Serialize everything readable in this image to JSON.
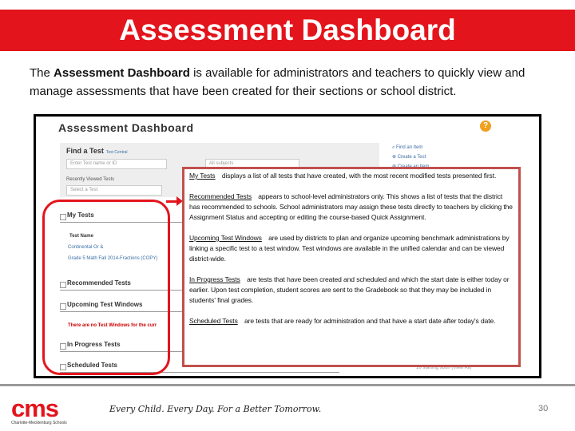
{
  "slide": {
    "title": "Assessment Dashboard",
    "intro_prefix": "The ",
    "intro_bold": "Assessment Dashboard",
    "intro_rest": " is available for administrators and teachers to quickly view and  manage assessments that have been created for their sections or school district.",
    "page_number": "30",
    "tagline": "Every Child. Every Day. For a Better Tomorrow.",
    "logo_text": "cms",
    "logo_subtext": "Charlotte-Mecklenburg Schools"
  },
  "screenshot": {
    "title": "Assessment Dashboard",
    "help_icon": "?",
    "find": {
      "label": "Find a Test",
      "link": "Test Central",
      "name_placeholder": "Enter Test name or ID",
      "subject": "All subjects",
      "recent_label": "Recently Viewed Tests",
      "recent_value": "Select a Test"
    },
    "right_links": [
      "Find an Item",
      "Create a Test",
      "Create an Item"
    ],
    "sections": {
      "my_tests": "My Tests",
      "test_name_header": "Test Name",
      "tests": [
        "Continental Or &",
        "Grade 5 Math Fall 2014-Fractions (COPY)"
      ],
      "recommended": "Recommended Tests",
      "upcoming": "Upcoming Test Windows",
      "upcoming_empty": "There are no Test Windows for the curr",
      "in_progress": "In Progress Tests",
      "scheduled": "Scheduled Tests",
      "footer_link": "10 starting soon (View All)"
    }
  },
  "overlay": [
    {
      "term": "My Tests",
      "text": "displays a list of all tests that have created, with the most recent modified tests presented first."
    },
    {
      "term": "Recommended Tests",
      "text": "appears to school-level administrators only.  This shows a list of tests that the district has recommended to schools. School administrators may assign these tests directly to teachers by clicking the Assignment Status and accepting or editing the course-based Quick Assignment."
    },
    {
      "term": "Upcoming Test Windows",
      "text": "are used by districts to plan and organize upcoming benchmark administrations by linking a   specific test to a test window.  Test windows are available in the unified calendar and  can be viewed district-wide."
    },
    {
      "term": "In Progress Tests",
      "text": "are tests that have been created and scheduled and which the start date is either today or earlier.  Upon test completion, student scores are sent to the Gradebook so that they may be included in students' final grades."
    },
    {
      "term": "Scheduled Tests",
      "text": "are tests that are ready for administration and that have a start date after today's date."
    }
  ],
  "colors": {
    "brand_red": "#e3141c",
    "callout_border": "#c0504d",
    "link": "#3a6ea5"
  }
}
